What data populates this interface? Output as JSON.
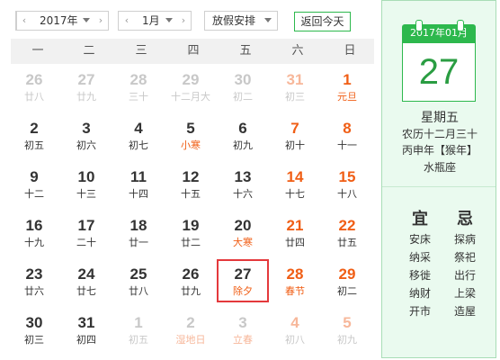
{
  "toolbar": {
    "year_prev": "‹",
    "year_label": "2017年",
    "year_next": "›",
    "month_prev": "‹",
    "month_label": "1月",
    "month_next": "›",
    "holiday_label": "放假安排",
    "today_button": "返回今天"
  },
  "weekdays": [
    "一",
    "二",
    "三",
    "四",
    "五",
    "六",
    "日"
  ],
  "weeks": [
    [
      {
        "day": "26",
        "lunar": "廿八",
        "other": true
      },
      {
        "day": "27",
        "lunar": "廿九",
        "other": true
      },
      {
        "day": "28",
        "lunar": "三十",
        "other": true
      },
      {
        "day": "29",
        "lunar": "十二月大",
        "other": true
      },
      {
        "day": "30",
        "lunar": "初二",
        "other": true
      },
      {
        "day": "31",
        "lunar": "初三",
        "other": true,
        "weekend": true
      },
      {
        "day": "1",
        "lunar": "元旦",
        "weekend": true,
        "holiday": true
      }
    ],
    [
      {
        "day": "2",
        "lunar": "初五"
      },
      {
        "day": "3",
        "lunar": "初六"
      },
      {
        "day": "4",
        "lunar": "初七"
      },
      {
        "day": "5",
        "lunar": "小寒",
        "term": true
      },
      {
        "day": "6",
        "lunar": "初九"
      },
      {
        "day": "7",
        "lunar": "初十",
        "weekend": true
      },
      {
        "day": "8",
        "lunar": "十一",
        "weekend": true
      }
    ],
    [
      {
        "day": "9",
        "lunar": "十二"
      },
      {
        "day": "10",
        "lunar": "十三"
      },
      {
        "day": "11",
        "lunar": "十四"
      },
      {
        "day": "12",
        "lunar": "十五"
      },
      {
        "day": "13",
        "lunar": "十六"
      },
      {
        "day": "14",
        "lunar": "十七",
        "weekend": true
      },
      {
        "day": "15",
        "lunar": "十八",
        "weekend": true
      }
    ],
    [
      {
        "day": "16",
        "lunar": "十九"
      },
      {
        "day": "17",
        "lunar": "二十"
      },
      {
        "day": "18",
        "lunar": "廿一"
      },
      {
        "day": "19",
        "lunar": "廿二"
      },
      {
        "day": "20",
        "lunar": "大寒",
        "term": true
      },
      {
        "day": "21",
        "lunar": "廿四",
        "weekend": true
      },
      {
        "day": "22",
        "lunar": "廿五",
        "weekend": true
      }
    ],
    [
      {
        "day": "23",
        "lunar": "廿六"
      },
      {
        "day": "24",
        "lunar": "廿七"
      },
      {
        "day": "25",
        "lunar": "廿八"
      },
      {
        "day": "26",
        "lunar": "廿九"
      },
      {
        "day": "27",
        "lunar": "除夕",
        "holiday": true,
        "selected": true
      },
      {
        "day": "28",
        "lunar": "春节",
        "weekend": true,
        "holiday": true
      },
      {
        "day": "29",
        "lunar": "初二",
        "weekend": true
      }
    ],
    [
      {
        "day": "30",
        "lunar": "初三"
      },
      {
        "day": "31",
        "lunar": "初四"
      },
      {
        "day": "1",
        "lunar": "初五",
        "other": true
      },
      {
        "day": "2",
        "lunar": "湿地日",
        "other": true,
        "term": true
      },
      {
        "day": "3",
        "lunar": "立春",
        "other": true,
        "term": true
      },
      {
        "day": "4",
        "lunar": "初八",
        "other": true,
        "weekend": true
      },
      {
        "day": "5",
        "lunar": "初九",
        "other": true,
        "weekend": true
      }
    ]
  ],
  "side": {
    "card_header": "2017年01月",
    "card_day": "27",
    "weekday": "星期五",
    "lunar_date": "农历十二月三十",
    "ganzhi_year": "丙申年【猴年】",
    "wuxing": "水瓶座",
    "yi_title": "宜",
    "ji_title": "忌",
    "yi_items": [
      "安床",
      "纳采",
      "移徙",
      "纳财",
      "开市"
    ],
    "ji_items": [
      "探病",
      "祭祀",
      "出行",
      "上梁",
      "造屋"
    ]
  },
  "colors": {
    "accent_green": "#2db84d",
    "weekend_orange": "#f05e15",
    "selected_red": "#e4393c",
    "side_bg": "#eafaef"
  }
}
